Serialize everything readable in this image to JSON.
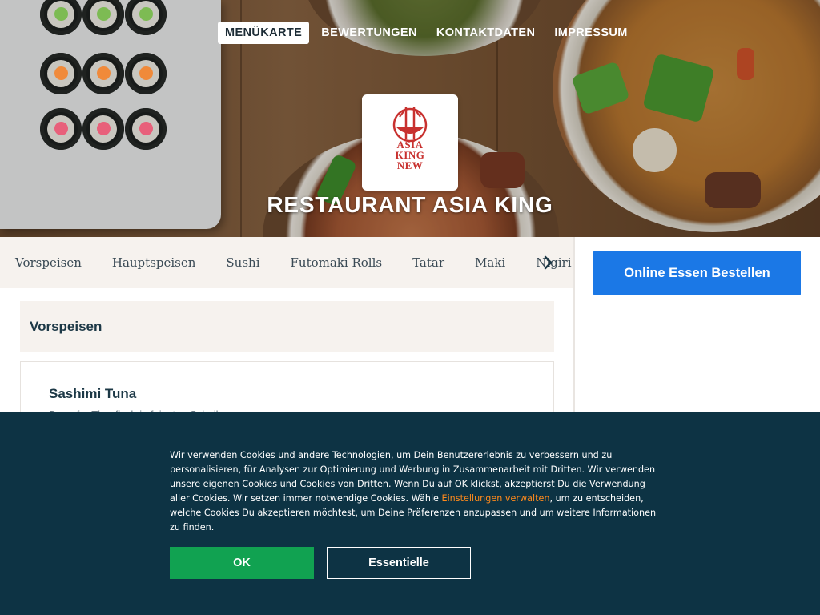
{
  "topnav": {
    "items": [
      "MENÜKARTE",
      "BEWERTUNGEN",
      "KONTAKTDATEN",
      "IMPRESSUM"
    ],
    "active_index": 0
  },
  "logo": {
    "lines": [
      "ASIA",
      "KING",
      "NEW"
    ],
    "icon": "noodle-bowl-chopsticks-icon"
  },
  "restaurant": {
    "name": "RESTAURANT ASIA KING"
  },
  "categories": {
    "items": [
      "Vorspeisen",
      "Hauptspeisen",
      "Sushi",
      "Futomaki Rolls",
      "Tatar",
      "Maki",
      "Nigiri"
    ],
    "next_icon": "chevron-right-icon"
  },
  "sidebar": {
    "order_button": "Online Essen Bestellen",
    "order_button_color": "#1b78e6"
  },
  "menu": {
    "section_title": "Vorspeisen",
    "items": [
      {
        "name": "Sashimi Tuna",
        "description": "Dampfer Thunfisch in feinsten Scheiben"
      }
    ]
  },
  "cookie": {
    "text_before": "Wir verwenden Cookies und andere Technologien, um Dein Benutzererlebnis zu verbessern und zu personalisieren, für Analysen zur Optimierung und Werbung in Zusammenarbeit mit Dritten. Wir verwenden unsere eigenen Cookies und Cookies von Dritten. Wenn Du auf OK klickst, akzeptierst Du die Verwendung aller Cookies. Wir setzen immer notwendige Cookies. Wähle ",
    "link_text": "Einstellungen verwalten",
    "text_after": ", um zu entscheiden, welche Cookies Du akzeptieren möchtest, um Deine Präferenzen anzupassen und um weitere Informationen zu finden.",
    "ok_label": "OK",
    "essential_label": "Essentielle",
    "background_color": "#0d3344",
    "ok_color": "#11a251",
    "link_color": "#ff8a1c"
  }
}
